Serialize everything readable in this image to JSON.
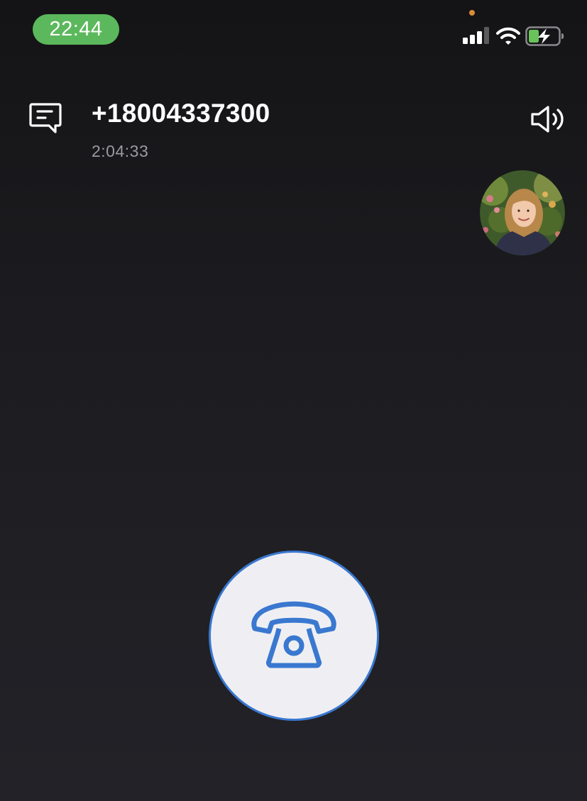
{
  "status_bar": {
    "time": "22:44"
  },
  "call": {
    "phone_number": "+18004337300",
    "duration": "2:04:33"
  },
  "icons": {
    "chat": "message-icon",
    "speaker": "speaker-icon",
    "call": "telephone-icon"
  },
  "colors": {
    "time_pill": "#5cb85c",
    "accent": "#3a78d0",
    "call_button_bg": "#efeff3",
    "privacy_dot": "#d98b3a",
    "battery_fill": "#6ac25a"
  }
}
